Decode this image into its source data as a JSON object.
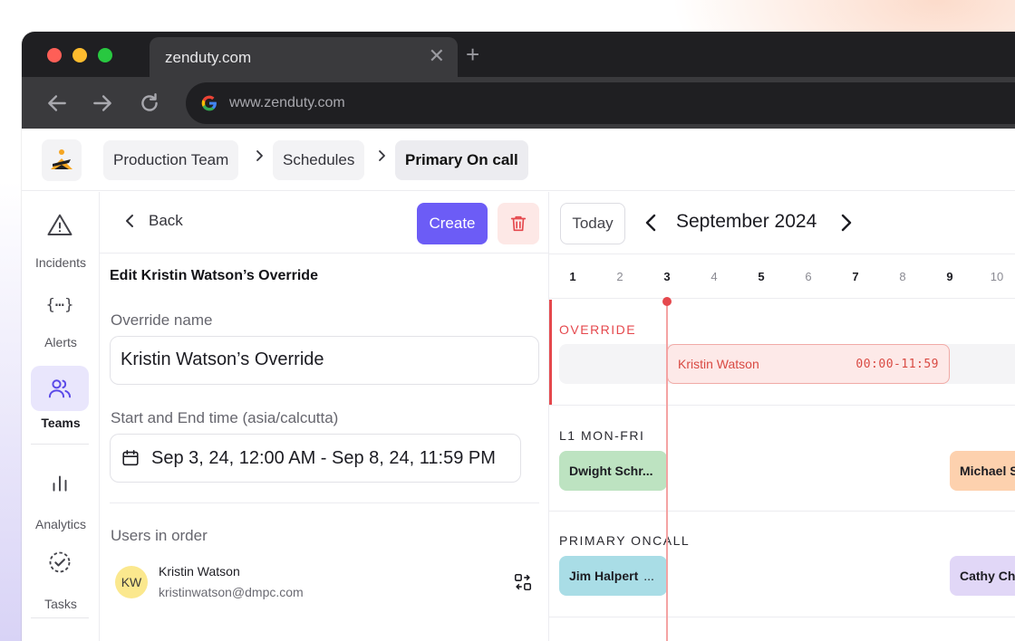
{
  "browser": {
    "tab_title": "zenduty.com",
    "url": "www.zenduty.com"
  },
  "breadcrumb": [
    "Production Team",
    "Schedules",
    "Primary On call"
  ],
  "sidebar": {
    "items": [
      {
        "label": "Incidents",
        "icon": "warning-triangle-icon"
      },
      {
        "label": "Alerts",
        "icon": "braces-icon"
      },
      {
        "label": "Teams",
        "icon": "users-icon",
        "active": true
      },
      {
        "label": "Analytics",
        "icon": "bar-chart-icon"
      },
      {
        "label": "Tasks",
        "icon": "check-circle-icon"
      }
    ]
  },
  "panel": {
    "back_label": "Back",
    "create_label": "Create",
    "title": "Edit Kristin Watson’s Override",
    "override_name_label": "Override name",
    "override_name_value": "Kristin Watson’s Override",
    "time_label": "Start and End time (asia/calcutta)",
    "time_value": "Sep 3, 24, 12:00 AM - Sep 8, 24, 11:59 PM",
    "users_label": "Users in order",
    "user": {
      "initials": "KW",
      "name": "Kristin Watson",
      "email": "kristinwatson@dmpc.com"
    }
  },
  "calendar": {
    "today_label": "Today",
    "month_label": "September 2024",
    "days": [
      "1",
      "2",
      "3",
      "4",
      "5",
      "6",
      "7",
      "8",
      "9",
      "10"
    ],
    "sections": [
      {
        "label": "OVERRIDE",
        "events": [
          {
            "name": "Kristin Watson",
            "time": "00:00-11:59"
          }
        ]
      },
      {
        "label": "L1 MON-FRI",
        "events": [
          {
            "name": "Dwight Schr..."
          },
          {
            "name": "Michael S"
          }
        ]
      },
      {
        "label": "PRIMARY ONCALL",
        "events": [
          {
            "name": "Jim Halpert",
            "more": "..."
          },
          {
            "name": "Cathy Ch"
          }
        ]
      }
    ]
  },
  "colors": {
    "accent": "#6c5cf6",
    "override_red": "#e5484d",
    "event_green": "#bde3c1",
    "event_orange": "#fdd1ae",
    "event_blue": "#a9dde6",
    "event_purple": "#e1d7f7"
  }
}
